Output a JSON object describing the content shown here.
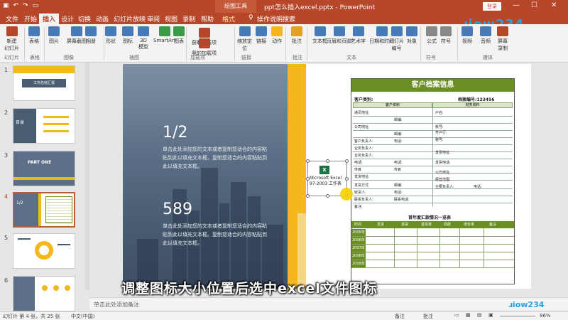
{
  "window": {
    "context_tab": "绘图工具",
    "document_title": "ppt怎么插入excel.pptx  -  PowerPoint",
    "login": "登录",
    "share": "共享",
    "controls": [
      "—",
      "☐",
      "✕"
    ]
  },
  "tabs": [
    "文件",
    "开始",
    "插入",
    "设计",
    "切换",
    "动画",
    "幻灯片放映",
    "审阅",
    "视图",
    "录制",
    "帮助",
    "格式",
    "操作说明搜索"
  ],
  "active_tab": "插入",
  "ribbon": {
    "buttons": [
      {
        "label": "新建\n幻灯片",
        "icon": "new-slide-icon",
        "color": "#b7472a"
      },
      {
        "label": "表格",
        "icon": "table-icon",
        "color": "#4a7ab5"
      },
      {
        "label": "图片",
        "icon": "picture-icon",
        "color": "#4a7ab5"
      },
      {
        "label": "屏幕截图",
        "icon": "screenshot-icon",
        "color": "#4a7ab5"
      },
      {
        "label": "相册",
        "icon": "album-icon",
        "color": "#4a7ab5"
      },
      {
        "label": "形状",
        "icon": "shapes-icon",
        "color": "#4a7ab5"
      },
      {
        "label": "图标",
        "icon": "icons-icon",
        "color": "#4a7ab5"
      },
      {
        "label": "3D\n模型",
        "icon": "3d-model-icon",
        "color": "#4a7ab5"
      },
      {
        "label": "SmartArt",
        "icon": "smartart-icon",
        "color": "#3c9a4a"
      },
      {
        "label": "图表",
        "icon": "chart-icon",
        "color": "#3c9a4a"
      },
      {
        "label": "获取加载项",
        "icon": "get-addins-icon",
        "color": "#b7472a"
      },
      {
        "label": "我的加载项",
        "icon": "my-addins-icon",
        "color": "#b7472a"
      },
      {
        "label": "缩放定\n位",
        "icon": "zoom-icon",
        "color": "#4a7ab5"
      },
      {
        "label": "链接",
        "icon": "link-icon",
        "color": "#4a7ab5"
      },
      {
        "label": "动作",
        "icon": "action-icon",
        "color": "#f4b81c"
      },
      {
        "label": "批注",
        "icon": "comment-icon",
        "color": "#e2a41f"
      },
      {
        "label": "文本框",
        "icon": "textbox-icon",
        "color": "#4a7ab5"
      },
      {
        "label": "页眉和页脚",
        "icon": "header-footer-icon",
        "color": "#4a7ab5"
      },
      {
        "label": "艺术字",
        "icon": "wordart-icon",
        "color": "#4a7ab5"
      },
      {
        "label": "日期和时间",
        "icon": "datetime-icon",
        "color": "#4a7ab5"
      },
      {
        "label": "幻灯片\n编号",
        "icon": "slide-number-icon",
        "color": "#4a7ab5"
      },
      {
        "label": "对象",
        "icon": "object-icon",
        "color": "#4a7ab5"
      },
      {
        "label": "公式",
        "icon": "equation-icon",
        "color": "#888888"
      },
      {
        "label": "符号",
        "icon": "symbol-icon",
        "color": "#888888"
      },
      {
        "label": "视频",
        "icon": "video-icon",
        "color": "#4a7ab5"
      },
      {
        "label": "音频",
        "icon": "audio-icon",
        "color": "#4a7ab5"
      },
      {
        "label": "屏幕\n录制",
        "icon": "screen-record-icon",
        "color": "#b7472a"
      }
    ],
    "groups": [
      "幻灯片",
      "表格",
      "图像",
      "插图",
      "加载项",
      "链接",
      "批注",
      "文本",
      "符号",
      "媒体"
    ]
  },
  "thumbnails": [
    {
      "num": "1",
      "caption": "工作总结汇报"
    },
    {
      "num": "2",
      "caption": "目录"
    },
    {
      "num": "3",
      "caption": "PART ONE"
    },
    {
      "num": "4",
      "caption": "1/2"
    },
    {
      "num": "5",
      "caption": ""
    },
    {
      "num": "6",
      "caption": ""
    }
  ],
  "slide": {
    "stat1": {
      "num": "1/2",
      "text": "单击此处添加您的文本或者复制您适合的内容粘贴到此以填充文本框，复制您适合的内容粘贴到此以填充文本框。"
    },
    "stat2": {
      "num": "589",
      "text": "单击此处添加您的文本或者复制您适合的内容粘贴到此以填充文本框。复制您适合的内容粘贴到此以填充文本框。"
    },
    "form": {
      "title": "客户档案信息",
      "customer_type": "客户类别:",
      "file_no": "档案编号:123456",
      "left_header": "客户资料",
      "right_header": "财务资料",
      "left_fields": [
        "通讯地址:",
        "邮编:",
        "公司地址:",
        "邮编:",
        "客户负责人:",
        "电话:",
        "业务负责人:",
        "业务负责人:",
        "电话:",
        "电话:",
        "传真",
        "传真",
        "发货地址:",
        "发货方式",
        "邮编:",
        "收货人:",
        "电话:",
        "联系负责人:",
        "联系电话:",
        "备注:"
      ],
      "right_fields": [
        "户名:",
        "账号:",
        "开户行:",
        "税号:",
        "发票地址:",
        "发票电话:",
        "公司地址:",
        "经营范围:",
        "主要负责人:",
        "电话:"
      ],
      "table_title": "首年度汇款情况一览表",
      "table_cols": [
        "时间",
        "发货",
        "退货",
        "退货率",
        "回款",
        "增长率",
        "备注"
      ],
      "years": [
        "2005年",
        "2006年",
        "2007年",
        "2008年",
        "2009年"
      ]
    },
    "object": {
      "icon_text": "X",
      "caption": "Microsoft Excel 97-2003 工作表"
    }
  },
  "notes": "单击此处添加备注",
  "status": {
    "slide_info": "幻灯片 第 4 张，共 25 张",
    "language": "中文(中国)",
    "notes_btn": "备注",
    "comments_btn": "批注",
    "zoom": "86%"
  },
  "subtitle": "调整图标大小位置后选中excel文件图标",
  "watermark": "ɹiow234"
}
